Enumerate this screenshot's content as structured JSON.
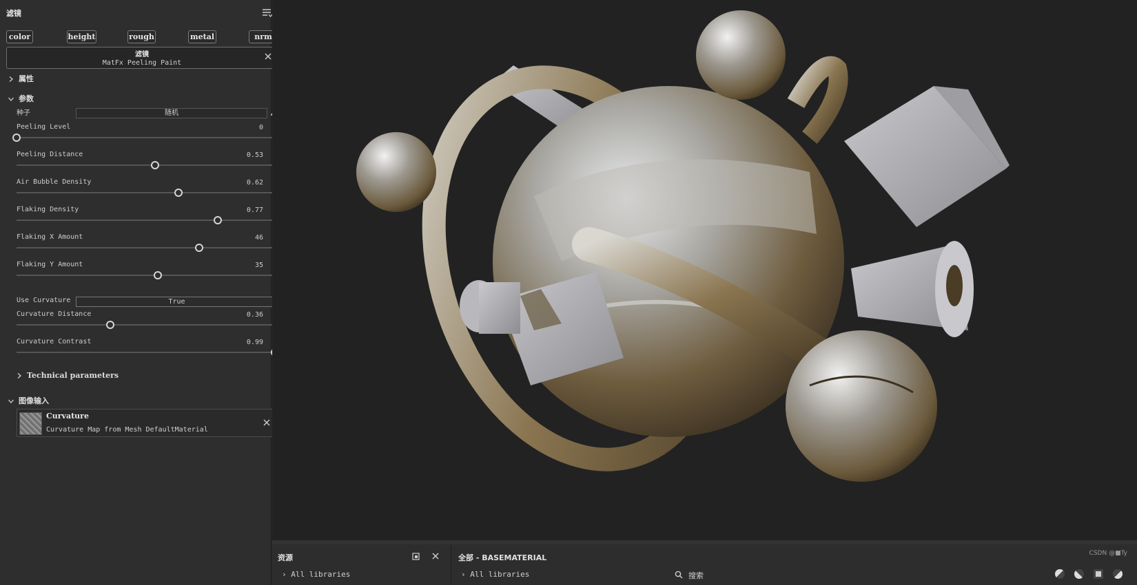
{
  "panel": {
    "title": "滤镜",
    "channels": [
      "color",
      "height",
      "rough",
      "metal",
      "nrm"
    ],
    "filter": {
      "title": "滤镜",
      "name": "MatFx Peeling Paint"
    }
  },
  "sections": {
    "properties": "属性",
    "parameters": "参数",
    "technical": "Technical parameters",
    "image_inputs": "图像输入"
  },
  "params": {
    "seed": {
      "label": "种子",
      "value": "随机"
    },
    "sliders": [
      {
        "label": "Peeling Level",
        "value": "0",
        "fraction": 0.0
      },
      {
        "label": "Peeling Distance",
        "value": "0.53",
        "fraction": 0.53
      },
      {
        "label": "Air Bubble Density",
        "value": "0.62",
        "fraction": 0.62
      },
      {
        "label": "Flaking Density",
        "value": "0.77",
        "fraction": 0.77
      },
      {
        "label": "Flaking X Amount",
        "value": "46",
        "fraction": 0.7
      },
      {
        "label": "Flaking Y Amount",
        "value": "35",
        "fraction": 0.54
      }
    ],
    "use_curvature": {
      "label": "Use Curvature",
      "value": "True"
    },
    "sliders2": [
      {
        "label": "Curvature Distance",
        "value": "0.36",
        "fraction": 0.36
      },
      {
        "label": "Curvature Contrast",
        "value": "0.99",
        "fraction": 0.99
      }
    ]
  },
  "image_input": {
    "name": "Curvature",
    "description": "Curvature Map from Mesh DefaultMaterial"
  },
  "bottom": {
    "assets_title": "资源",
    "library_title": "全部 - BASEMATERIAL",
    "all_libraries_left": "All libraries",
    "all_libraries_right": "All libraries",
    "search_placeholder": "搜索",
    "watermark": "CSDN @■Ty"
  },
  "colors": {
    "panel_bg": "#2e2e2e",
    "viewport_bg": "#222222",
    "accent": "#d6d6d6"
  },
  "icons": [
    "menu-icon",
    "close-icon",
    "chevron-right-icon",
    "chevron-down-icon",
    "pencil-icon",
    "search-icon",
    "popout-icon"
  ]
}
